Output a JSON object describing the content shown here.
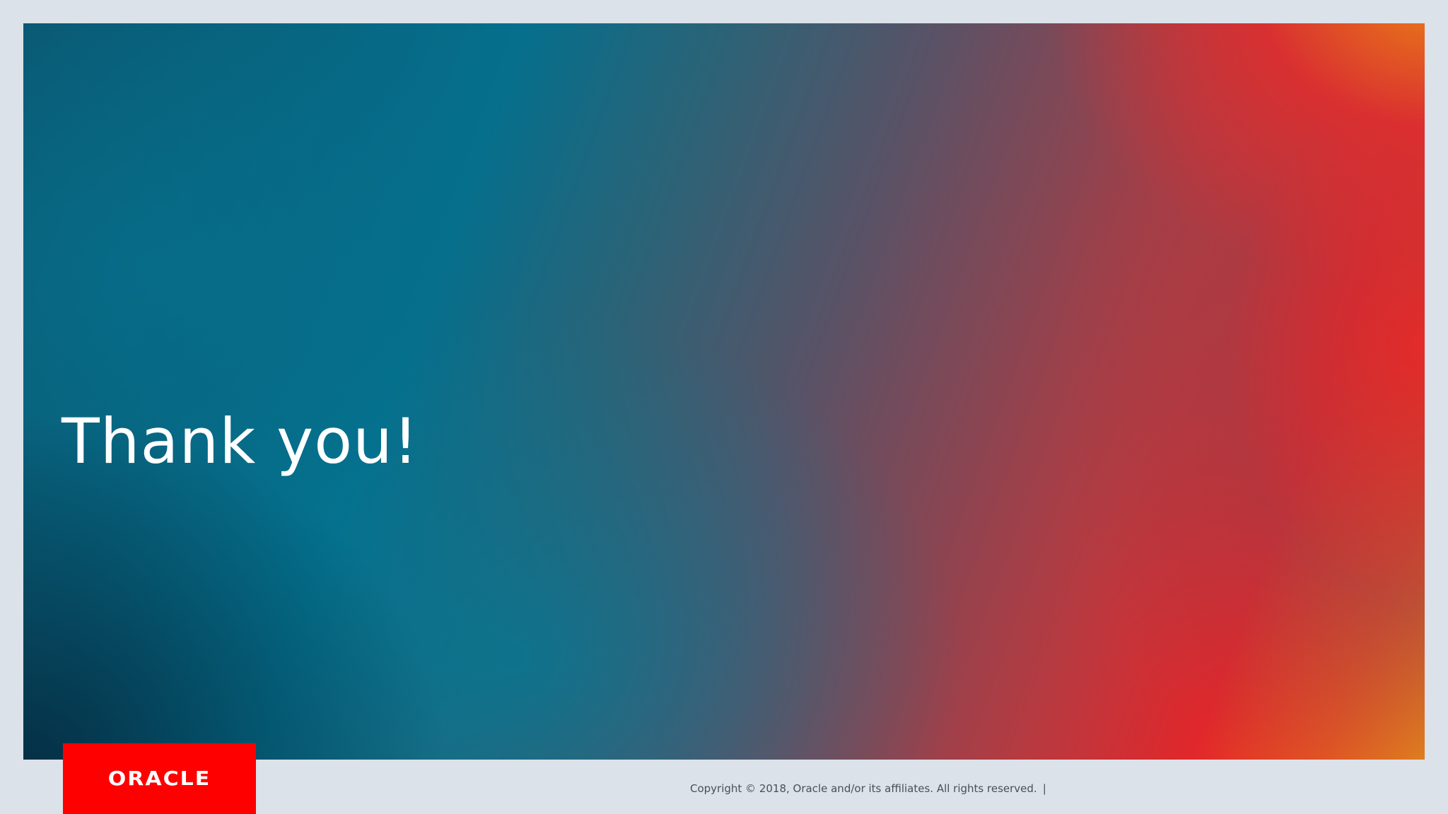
{
  "slide": {
    "title": "Thank you!"
  },
  "brand": {
    "logo_text": "ORACLE",
    "logo_color": "#ff0000"
  },
  "footer": {
    "copyright": "Copyright © 2018, Oracle and/or its affiliates. All rights reserved.",
    "separator": "|"
  },
  "colors": {
    "page_background": "#dce2e9",
    "teal": "#056f8c",
    "red": "#e1272b",
    "orange": "#ec8c16"
  }
}
